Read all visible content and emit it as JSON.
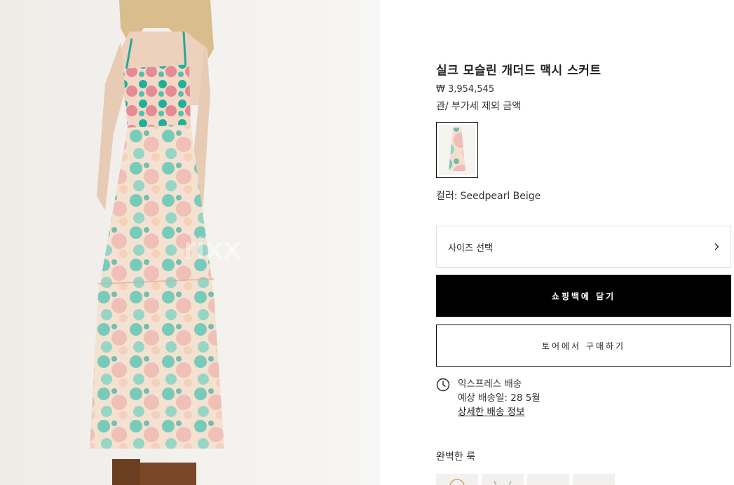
{
  "hero": {
    "watermark": "rixx"
  },
  "product": {
    "title": "실크 모슬린 개더드 맥시 스커트",
    "price": "₩ 3,954,545",
    "tax_note": "관/ 부가세 제외 금액",
    "color_label": "컬러:",
    "color_value": "Seedpearl Beige"
  },
  "size_select": {
    "label": "사이즈 선택",
    "icon": "chevron-right-icon"
  },
  "actions": {
    "add_to_bag": "쇼핑백에 담기",
    "buy_in_store": "토어에서 구매하기"
  },
  "delivery": {
    "icon": "clock-icon",
    "title": "익스프레스 배송",
    "estimate": "예상 배송일: 28 5월",
    "details_link": "상세한 배송 정보"
  },
  "complete_look": {
    "title": "완벽한 룩",
    "item_count": 4
  },
  "colors": {
    "primary_button_bg": "#000000",
    "primary_button_text": "#ffffff",
    "border": "#e2e2e2"
  }
}
